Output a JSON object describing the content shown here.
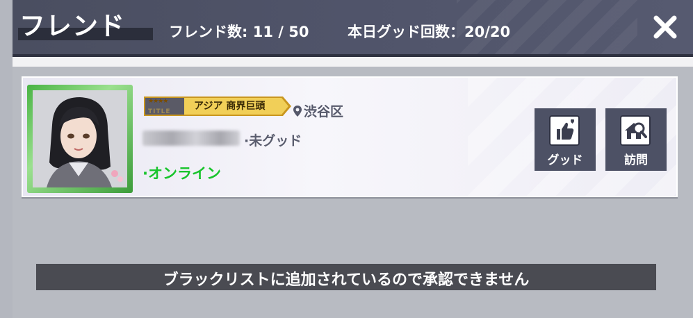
{
  "header": {
    "title": "フレンド",
    "friend_count": "フレンド数: 11 / 50",
    "good_count": "本日グッド回数：20/20"
  },
  "friend": {
    "title_badge": {
      "label": "アジア 商界巨頭",
      "sub": "TITLE"
    },
    "location": "渋谷区",
    "good_status": "·未グッド",
    "online_status": "·オンライン",
    "actions": {
      "good_label": "グッド",
      "visit_label": "訪問"
    }
  },
  "toast": {
    "message": "ブラックリストに追加されているので承認できません"
  },
  "colors": {
    "header_bg": "#4a4e60",
    "online": "#18c42c",
    "button_bg": "#4d5165",
    "frame_green": "#49b344",
    "badge_gold": "#e2b53a"
  },
  "icons": [
    "close-icon",
    "location-pin-icon",
    "thumbs-up-heart-icon",
    "visit-house-icon",
    "star-icon"
  ]
}
